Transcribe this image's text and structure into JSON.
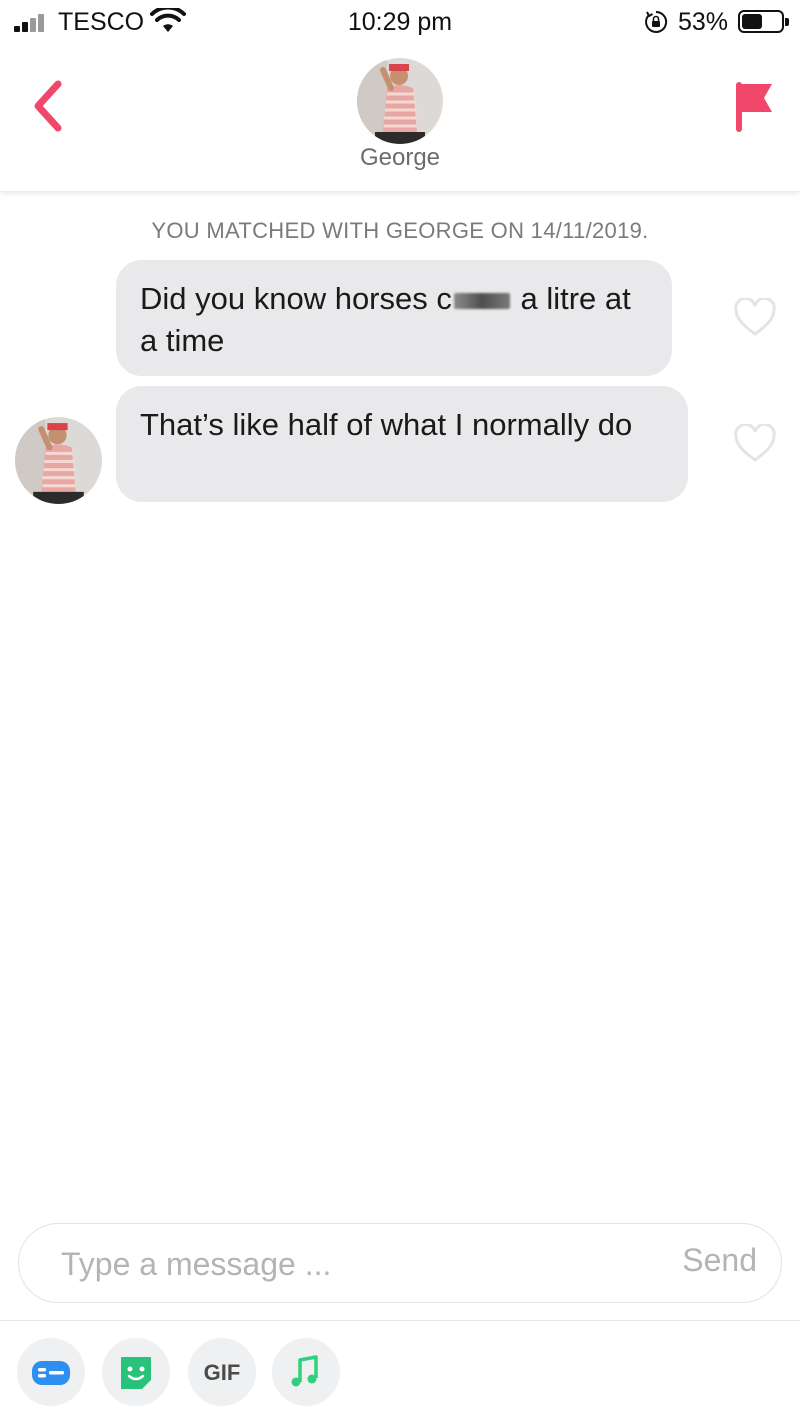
{
  "status_bar": {
    "carrier": "TESCO",
    "time": "10:29 pm",
    "battery_percent": "53%",
    "battery_level": 0.53
  },
  "header": {
    "match_name": "George"
  },
  "chat": {
    "match_notice": "YOU MATCHED WITH GEORGE ON 14/11/2019.",
    "messages": [
      {
        "text_before": "Did you know horses c",
        "text_after": " a litre at a time",
        "liked": false
      },
      {
        "text": "That’s like half of what I normally do",
        "liked": false
      }
    ]
  },
  "composer": {
    "placeholder": "Type a message ...",
    "send_label": "Send"
  },
  "toolbar": {
    "gif_label": "GIF",
    "icons": [
      "contact-card-icon",
      "smiley-sticker-icon",
      "gif-icon",
      "music-note-icon"
    ]
  },
  "colors": {
    "accent": "#f0476a",
    "bubble": "#e9e9eb",
    "contact_icon": "#2d8ff0",
    "sticker_icon": "#28c27a",
    "music_icon": "#2fd27a"
  }
}
